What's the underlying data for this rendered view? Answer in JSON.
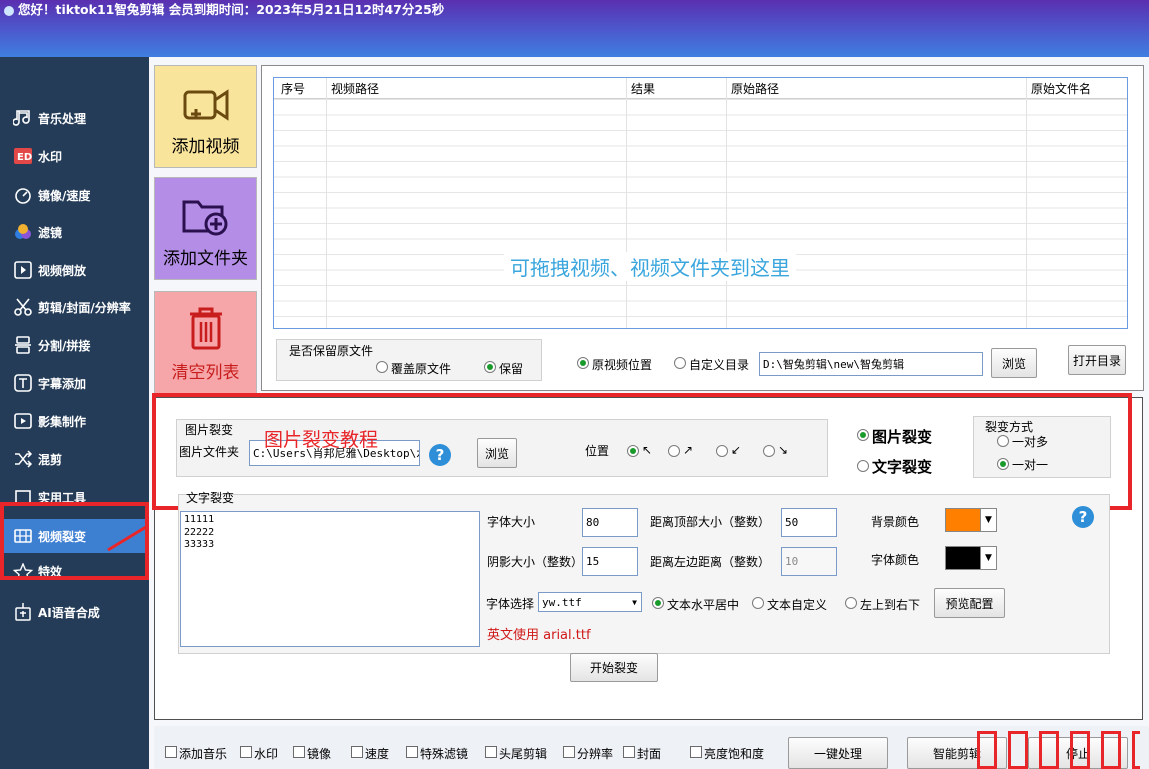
{
  "window": {
    "title": "您好！tiktok11智兔剪辑 会员到期时间：2023年5月21日12时47分25秒"
  },
  "sidebar": {
    "items": [
      {
        "label": "音乐处理",
        "icon": "music-note-icon"
      },
      {
        "label": "水印",
        "icon": "watermark-icon"
      },
      {
        "label": "镜像/速度",
        "icon": "speedometer-icon"
      },
      {
        "label": "滤镜",
        "icon": "filter-icon"
      },
      {
        "label": "视频倒放",
        "icon": "reverse-play-icon"
      },
      {
        "label": "剪辑/封面/分辨率",
        "icon": "scissors-icon"
      },
      {
        "label": "分割/拼接",
        "icon": "split-icon"
      },
      {
        "label": "字幕添加",
        "icon": "subtitle-icon"
      },
      {
        "label": "影集制作",
        "icon": "album-icon"
      },
      {
        "label": "混剪",
        "icon": "shuffle-icon"
      },
      {
        "label": "实用工具",
        "icon": "tools-icon"
      },
      {
        "label": "视频裂变",
        "icon": "video-split-icon"
      },
      {
        "label": "特效",
        "icon": "effects-icon"
      },
      {
        "label": "AI语音合成",
        "icon": "ai-voice-icon"
      }
    ],
    "active": "视频裂变"
  },
  "actions": {
    "add_video": "添加视频",
    "add_folder": "添加文件夹",
    "clear_list": "清空列表"
  },
  "table": {
    "columns": [
      "序号",
      "视频路径",
      "结果",
      "原始路径",
      "原始文件名"
    ],
    "rows": [],
    "drop_hint": "可拖拽视频、视频文件夹到这里"
  },
  "keep_original": {
    "title": "是否保留原文件",
    "overwrite": "覆盖原文件",
    "keep": "保留",
    "selected": "保留"
  },
  "output": {
    "original_position": "原视频位置",
    "custom_dir": "自定义目录",
    "path": "D:\\智兔剪辑\\new\\智兔剪辑",
    "browse": "浏览",
    "open_dir": "打开目录",
    "selected": "原视频位置"
  },
  "image_split": {
    "group_title": "图片裂变",
    "folder_label": "图片文件夹",
    "folder_path": "C:\\Users\\肖邦尼雅\\Desktop\\水",
    "browse": "浏览",
    "tutorial": "图片裂变教程",
    "position_label": "位置",
    "positions": [
      "↖",
      "↗",
      "↙",
      "↘"
    ],
    "position_selected": "↖"
  },
  "split_type": {
    "image": "图片裂变",
    "text": "文字裂变",
    "selected": "图片裂变"
  },
  "split_mode": {
    "title": "裂变方式",
    "one_to_many": "一对多",
    "one_to_one": "一对一",
    "selected": "一对一"
  },
  "text_split": {
    "group_title": "文字裂变",
    "lines": [
      "11111",
      "22222",
      "33333"
    ],
    "font_size_label": "字体大小",
    "font_size": "80",
    "top_dist_label": "距离顶部大小（整数）",
    "top_dist": "50",
    "bg_color_label": "背景颜色",
    "bg_color": "#ff8000",
    "shadow_label": "阴影大小（整数）",
    "shadow": "15",
    "left_dist_label": "距离左边距离（整数）",
    "left_dist": "10",
    "font_color_label": "字体颜色",
    "font_color": "#000000",
    "font_select_label": "字体选择",
    "font_file": "yw.ttf",
    "align_center": "文本水平居中",
    "align_custom": "文本自定义",
    "align_tl_br": "左上到右下",
    "align_selected": "文本水平居中",
    "preview": "预览配置",
    "english_note": "英文使用 arial.ttf"
  },
  "start_button": "开始裂变",
  "bottom": {
    "checks": [
      "添加音乐",
      "水印",
      "镜像",
      "速度",
      "特殊滤镜",
      "头尾剪辑",
      "分辨率",
      "封面",
      "亮度饱和度"
    ],
    "one_click": "一键处理",
    "smart_edit": "智能剪辑",
    "stop": "停止"
  }
}
